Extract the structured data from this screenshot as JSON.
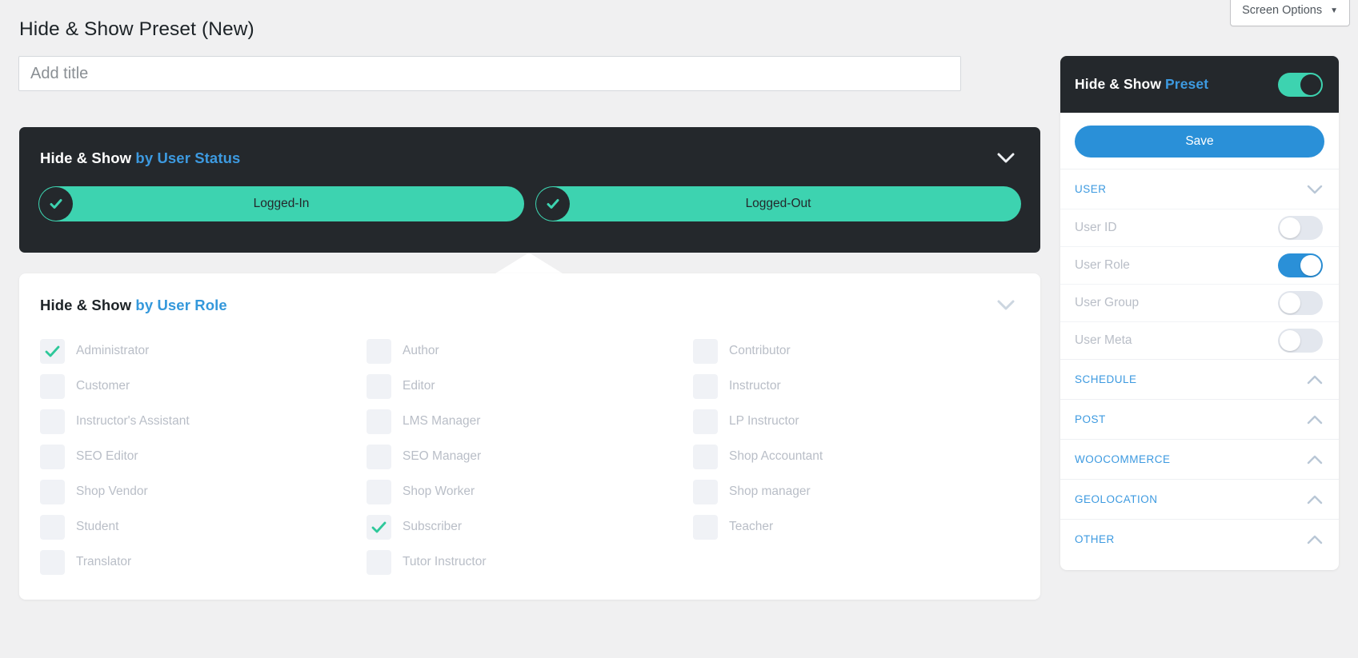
{
  "screen_options": {
    "label": "Screen Options",
    "caret": "▼",
    "icon": "chevron-down-icon"
  },
  "page": {
    "title": "Hide & Show Preset (New)"
  },
  "title_field": {
    "value": "",
    "placeholder": "Add title"
  },
  "status_panel": {
    "title_main": "Hide & Show",
    "title_accent": "by User Status",
    "collapse_icon": "chevron-down-icon",
    "options": [
      {
        "label": "Logged-In",
        "checked": true
      },
      {
        "label": "Logged-Out",
        "checked": true
      }
    ]
  },
  "role_panel": {
    "title_main": "Hide & Show",
    "title_accent": "by User Role",
    "collapse_icon": "chevron-down-icon",
    "roles": [
      {
        "label": "Administrator",
        "checked": true
      },
      {
        "label": "Author",
        "checked": false
      },
      {
        "label": "Contributor",
        "checked": false
      },
      {
        "label": "Customer",
        "checked": false
      },
      {
        "label": "Editor",
        "checked": false
      },
      {
        "label": "Instructor",
        "checked": false
      },
      {
        "label": "Instructor's Assistant",
        "checked": false
      },
      {
        "label": "LMS Manager",
        "checked": false
      },
      {
        "label": "LP Instructor",
        "checked": false
      },
      {
        "label": "SEO Editor",
        "checked": false
      },
      {
        "label": "SEO Manager",
        "checked": false
      },
      {
        "label": "Shop Accountant",
        "checked": false
      },
      {
        "label": "Shop Vendor",
        "checked": false
      },
      {
        "label": "Shop Worker",
        "checked": false
      },
      {
        "label": "Shop manager",
        "checked": false
      },
      {
        "label": "Student",
        "checked": false
      },
      {
        "label": "Subscriber",
        "checked": true
      },
      {
        "label": "Teacher",
        "checked": false
      },
      {
        "label": "Translator",
        "checked": false
      },
      {
        "label": "Tutor Instructor",
        "checked": false
      }
    ]
  },
  "sidebar": {
    "header": {
      "title_main": "Hide & Show",
      "title_accent": "Preset",
      "toggle_on": true,
      "toggle_color": "#3dd3b0"
    },
    "save_label": "Save",
    "sections": [
      {
        "label": "USER",
        "expanded": true,
        "chevron": "chevron-down-icon",
        "options": [
          {
            "label": "User ID",
            "on": false
          },
          {
            "label": "User Role",
            "on": true
          },
          {
            "label": "User Group",
            "on": false
          },
          {
            "label": "User Meta",
            "on": false
          }
        ]
      },
      {
        "label": "SCHEDULE",
        "expanded": false,
        "chevron": "chevron-up-icon",
        "options": []
      },
      {
        "label": "POST",
        "expanded": false,
        "chevron": "chevron-up-icon",
        "options": []
      },
      {
        "label": "WOOCOMMERCE",
        "expanded": false,
        "chevron": "chevron-up-icon",
        "options": []
      },
      {
        "label": "GEOLOCATION",
        "expanded": false,
        "chevron": "chevron-up-icon",
        "options": []
      },
      {
        "label": "OTHER",
        "expanded": false,
        "chevron": "chevron-up-icon",
        "options": []
      }
    ]
  },
  "colors": {
    "page_bg": "#f0f0f1",
    "dark_panel": "#24282c",
    "teal": "#3dd3b0",
    "blue": "#2a90d8",
    "accent_link": "#3d9ae0",
    "muted_text": "#b9bec7"
  }
}
